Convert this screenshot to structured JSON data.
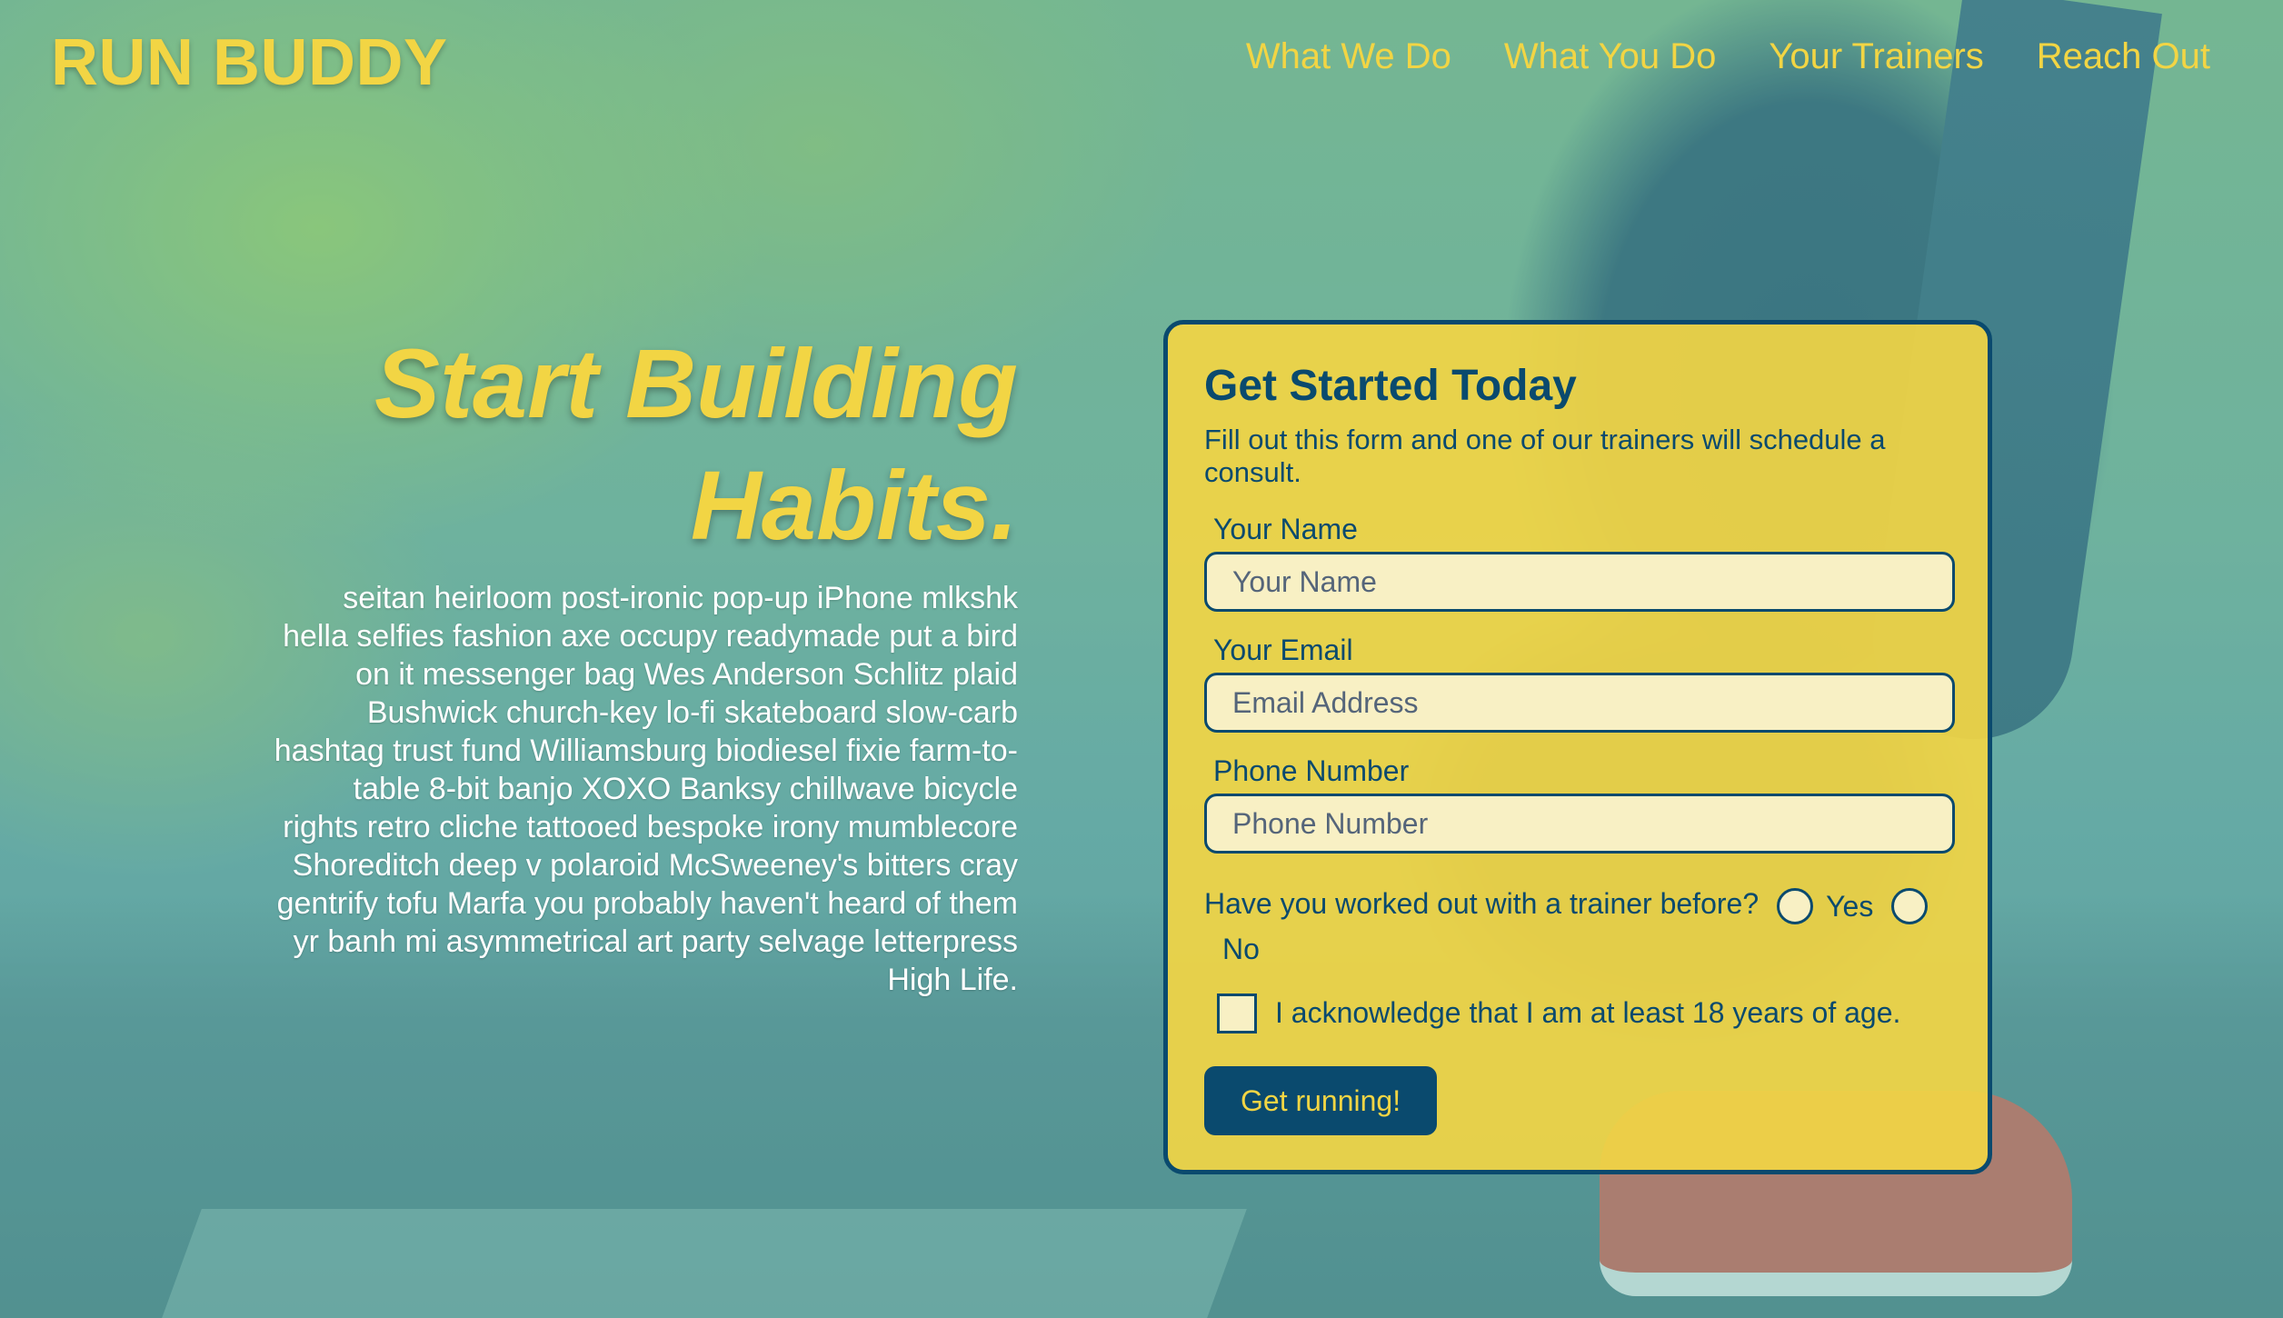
{
  "header": {
    "logo": "RUN BUDDY",
    "nav": [
      {
        "label": "What We Do"
      },
      {
        "label": "What You Do"
      },
      {
        "label": "Your Trainers"
      },
      {
        "label": "Reach Out"
      }
    ]
  },
  "hero": {
    "title_line1": "Start Building",
    "title_line2": "Habits.",
    "body": "seitan heirloom post-ironic pop-up iPhone mlkshk hella selfies fashion axe occupy readymade put a bird on it messenger bag Wes Anderson Schlitz plaid Bushwick church-key lo-fi skateboard slow-carb hashtag trust fund Williamsburg biodiesel fixie farm-to-table 8-bit banjo XOXO Banksy chillwave bicycle rights retro cliche tattooed bespoke irony mumblecore Shoreditch deep v polaroid McSweeney's bitters cray gentrify tofu Marfa you probably haven't heard of them yr banh mi asymmetrical art party selvage letterpress High Life."
  },
  "form": {
    "title": "Get Started Today",
    "subtitle": "Fill out this form and one of our trainers will schedule a consult.",
    "name": {
      "label": "Your Name",
      "placeholder": "Your Name",
      "value": ""
    },
    "email": {
      "label": "Your Email",
      "placeholder": "Email Address",
      "value": ""
    },
    "phone": {
      "label": "Phone Number",
      "placeholder": "Phone Number",
      "value": ""
    },
    "trainer_question": "Have you worked out with a trainer before?",
    "option_yes": "Yes",
    "option_no": "No",
    "age_ack": "I acknowledge that I am at least 18 years of age.",
    "submit": "Get running!"
  },
  "colors": {
    "accent": "#f2d544",
    "brand_dark": "#0a4a6e",
    "overlay_teal": "#58b0aa"
  }
}
